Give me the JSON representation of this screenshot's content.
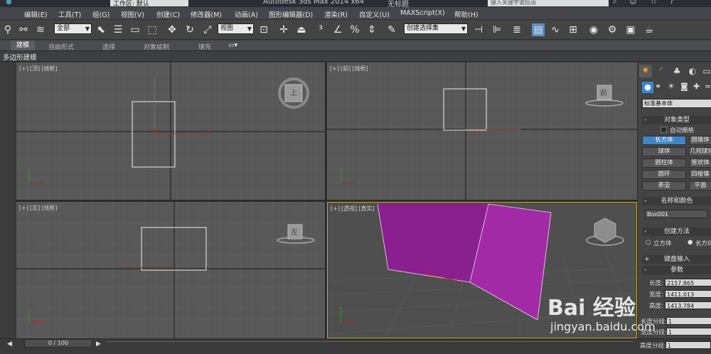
{
  "window": {
    "workspace": "工作区: 默认",
    "title": "Autodesk 3ds Max  2014 x64",
    "doc_title": "无标题",
    "search_placeholder": "键入关键字或短语"
  },
  "menu": [
    "编辑(E)",
    "工具(T)",
    "组(G)",
    "视图(V)",
    "创建(C)",
    "修改器(M)",
    "动画(A)",
    "图形编辑器(D)",
    "渲染(R)",
    "自定义(U)",
    "MAXScript(X)",
    "帮助(H)"
  ],
  "toolbar": {
    "selection_filter": "全部",
    "ref_coord": "视图",
    "named_selection": "创建选择集"
  },
  "ribbon": {
    "tabs": [
      "建模",
      "自由形式",
      "选择",
      "对象绘制",
      "填充"
    ],
    "active_tab": "建模",
    "sub_label": "多边形建模"
  },
  "viewports": {
    "top": {
      "plus": "[+]",
      "view": "[顶]",
      "shade": "[线框]"
    },
    "front": {
      "plus": "[+]",
      "view": "[前]",
      "shade": "[线框]"
    },
    "left": {
      "plus": "[+]",
      "view": "[左]",
      "shade": "[线框]"
    },
    "persp": {
      "plus": "[+]",
      "view": "[透视]",
      "shade": "[真实]"
    },
    "viewcube_top": "上",
    "viewcube_front": "前",
    "viewcube_left": "左"
  },
  "command_panel": {
    "category": "标准基本体",
    "object_type_header": "对象类型",
    "autogrid": "自动栅格",
    "buttons": [
      "长方体",
      "圆锥体",
      "球体",
      "几何球体",
      "圆柱体",
      "管状体",
      "圆环",
      "四棱锥",
      "茶壶",
      "平面"
    ],
    "active_button": "长方体",
    "name_color_header": "名称和颜色",
    "object_name": "Box001",
    "creation_method_header": "创建方法",
    "method_cube": "立方体",
    "method_box": "长方体",
    "keyboard_entry_header": "键盘输入",
    "parameters_header": "参数",
    "length_label": "长度:",
    "length_value": "2157.865",
    "width_label": "宽度:",
    "width_value": "1411.013",
    "height_label": "高度:",
    "height_value": "1413.784",
    "length_segs_label": "长度分段:",
    "length_segs_value": "1",
    "width_segs_label": "宽度分段:",
    "width_segs_value": "1",
    "height_segs_label": "高度分段:",
    "height_segs_value": "1"
  },
  "status": {
    "time_slider": "0 / 100"
  },
  "watermark": {
    "brand": "Bai 经验",
    "url": "jingyan.baidu.com"
  },
  "colors": {
    "box_front": "#8a1f8f",
    "box_side": "#a32aa7",
    "box_top": "#b735b7",
    "active_button": "#3d87c9",
    "viewport_bg": "#585858"
  }
}
